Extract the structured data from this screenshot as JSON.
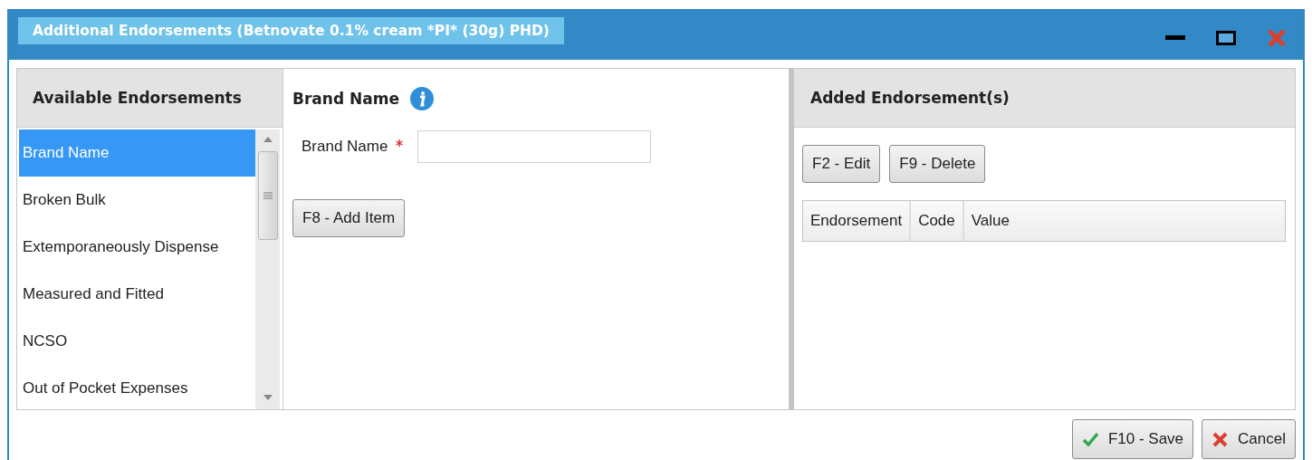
{
  "window": {
    "title": "Additional Endorsements (Betnovate 0.1% cream *PI* (30g) PHD)"
  },
  "available": {
    "header": "Available Endorsements",
    "items": [
      {
        "label": "Brand Name",
        "selected": true
      },
      {
        "label": "Broken Bulk",
        "selected": false
      },
      {
        "label": "Extemporaneously Dispense",
        "selected": false
      },
      {
        "label": "Measured and Fitted",
        "selected": false
      },
      {
        "label": "NCSO",
        "selected": false
      },
      {
        "label": "Out of Pocket Expenses",
        "selected": false
      }
    ]
  },
  "form": {
    "title": "Brand Name",
    "fields": [
      {
        "label": "Brand Name",
        "required": true
      }
    ],
    "add_button": "F8 - Add Item"
  },
  "added": {
    "header": "Added Endorsement(s)",
    "buttons": [
      "F2 - Edit",
      "F9 - Delete"
    ],
    "table": {
      "columns": [
        "Endorsement",
        "Code",
        "Value"
      ]
    }
  },
  "footer": {
    "buttons": [
      {
        "label": "F10 - Save",
        "kind": "save"
      },
      {
        "label": "Cancel",
        "kind": "cancel"
      }
    ]
  }
}
